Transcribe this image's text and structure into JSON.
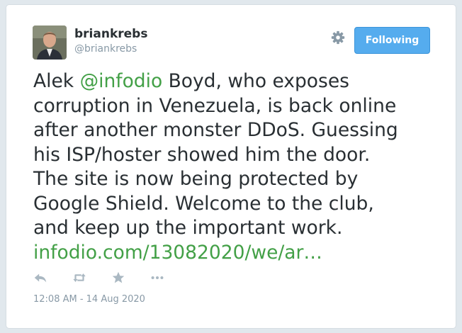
{
  "colors": {
    "background": "#e1e8ed",
    "card": "#ffffff",
    "text": "#292f33",
    "muted": "#8899a6",
    "link": "#43a047",
    "follow_button": "#55acee",
    "icon": "#aab8c2"
  },
  "user": {
    "display_name": "briankrebs",
    "handle": "@briankrebs",
    "avatar_icon": "profile-photo"
  },
  "header": {
    "settings_icon": "gear-icon",
    "follow_label": "Following"
  },
  "tweet": {
    "lines": [
      {
        "before": "Alek ",
        "mention": "@infodio",
        "after": " Boyd, who exposes"
      },
      {
        "text": "corruption in Venezuela, is back online"
      },
      {
        "text": "after another monster DDoS. Guessing"
      },
      {
        "text": "his ISP/hoster showed him the door."
      },
      {
        "text": "The site is now being protected by"
      },
      {
        "text": "Google Shield. Welcome to the club,"
      },
      {
        "text": "and keep up the important work."
      }
    ],
    "link": "infodio.com/13082020/we/ar…"
  },
  "actions": [
    {
      "icon": "reply-icon"
    },
    {
      "icon": "retweet-icon"
    },
    {
      "icon": "favorite-icon"
    },
    {
      "icon": "more-icon"
    }
  ],
  "timestamp": "12:08 AM - 14 Aug 2020"
}
